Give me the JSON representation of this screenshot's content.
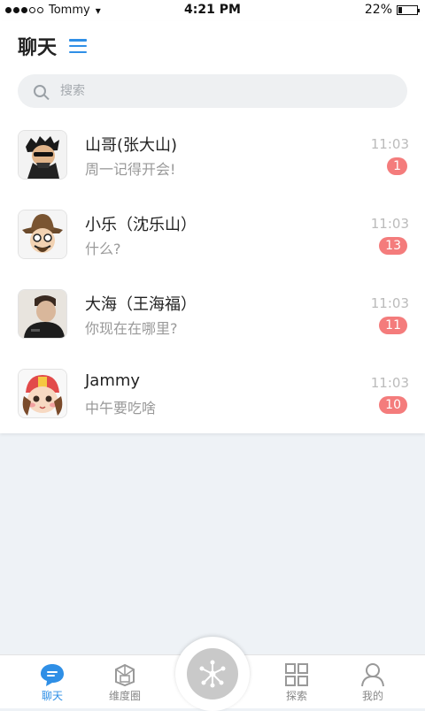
{
  "status_bar": {
    "carrier": "Tommy",
    "time": "4:21 PM",
    "battery": "22%",
    "battery_level": 0.22
  },
  "header": {
    "title": "聊天"
  },
  "search": {
    "placeholder": "搜索"
  },
  "chats": [
    {
      "name": "山哥(张大山)",
      "preview": "周一记得开会!",
      "time": "11:03",
      "unread": "1",
      "avatar": "avatar-shange"
    },
    {
      "name": "小乐（沈乐山）",
      "preview": "什么?",
      "time": "11:03",
      "unread": "13",
      "avatar": "avatar-xiaole"
    },
    {
      "name": "大海（王海福）",
      "preview": "你现在在哪里?",
      "time": "11:03",
      "unread": "11",
      "avatar": "avatar-dahai"
    },
    {
      "name": "Jammy",
      "preview": "中午要吃啥",
      "time": "11:03",
      "unread": "10",
      "avatar": "avatar-jammy"
    }
  ],
  "tabs": [
    {
      "label": "聊天",
      "icon": "chat-bubble-icon",
      "active": true
    },
    {
      "label": "维度圈",
      "icon": "dimension-circle-icon",
      "active": false
    },
    {
      "label": "",
      "icon": "hub-icon",
      "active": false
    },
    {
      "label": "探索",
      "icon": "grid-icon",
      "active": false
    },
    {
      "label": "我的",
      "icon": "person-icon",
      "active": false
    }
  ],
  "colors": {
    "accent": "#2f8fe6",
    "badge": "#f47c7c",
    "background": "#eef2f6"
  }
}
